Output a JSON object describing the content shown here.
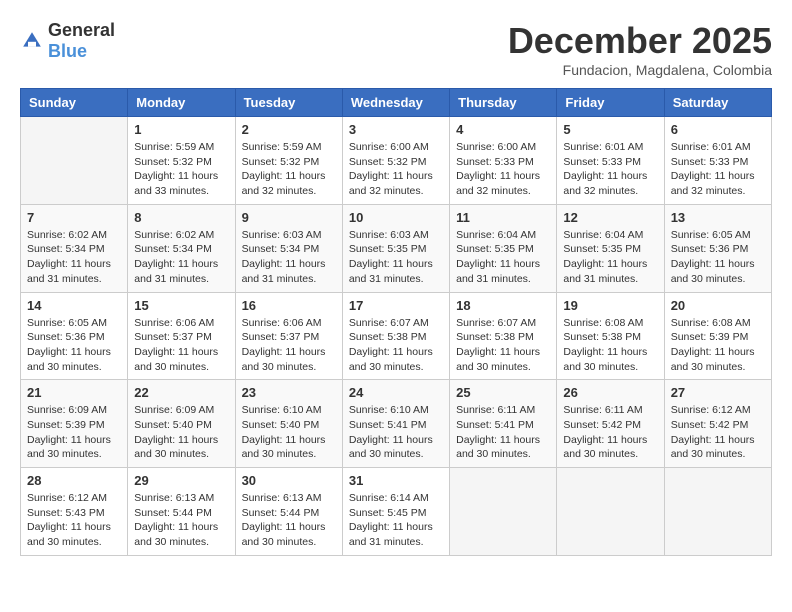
{
  "logo": {
    "general": "General",
    "blue": "Blue"
  },
  "title": "December 2025",
  "subtitle": "Fundacion, Magdalena, Colombia",
  "days_of_week": [
    "Sunday",
    "Monday",
    "Tuesday",
    "Wednesday",
    "Thursday",
    "Friday",
    "Saturday"
  ],
  "weeks": [
    [
      {
        "day": "",
        "info": ""
      },
      {
        "day": "1",
        "info": "Sunrise: 5:59 AM\nSunset: 5:32 PM\nDaylight: 11 hours\nand 33 minutes."
      },
      {
        "day": "2",
        "info": "Sunrise: 5:59 AM\nSunset: 5:32 PM\nDaylight: 11 hours\nand 32 minutes."
      },
      {
        "day": "3",
        "info": "Sunrise: 6:00 AM\nSunset: 5:32 PM\nDaylight: 11 hours\nand 32 minutes."
      },
      {
        "day": "4",
        "info": "Sunrise: 6:00 AM\nSunset: 5:33 PM\nDaylight: 11 hours\nand 32 minutes."
      },
      {
        "day": "5",
        "info": "Sunrise: 6:01 AM\nSunset: 5:33 PM\nDaylight: 11 hours\nand 32 minutes."
      },
      {
        "day": "6",
        "info": "Sunrise: 6:01 AM\nSunset: 5:33 PM\nDaylight: 11 hours\nand 32 minutes."
      }
    ],
    [
      {
        "day": "7",
        "info": "Sunrise: 6:02 AM\nSunset: 5:34 PM\nDaylight: 11 hours\nand 31 minutes."
      },
      {
        "day": "8",
        "info": "Sunrise: 6:02 AM\nSunset: 5:34 PM\nDaylight: 11 hours\nand 31 minutes."
      },
      {
        "day": "9",
        "info": "Sunrise: 6:03 AM\nSunset: 5:34 PM\nDaylight: 11 hours\nand 31 minutes."
      },
      {
        "day": "10",
        "info": "Sunrise: 6:03 AM\nSunset: 5:35 PM\nDaylight: 11 hours\nand 31 minutes."
      },
      {
        "day": "11",
        "info": "Sunrise: 6:04 AM\nSunset: 5:35 PM\nDaylight: 11 hours\nand 31 minutes."
      },
      {
        "day": "12",
        "info": "Sunrise: 6:04 AM\nSunset: 5:35 PM\nDaylight: 11 hours\nand 31 minutes."
      },
      {
        "day": "13",
        "info": "Sunrise: 6:05 AM\nSunset: 5:36 PM\nDaylight: 11 hours\nand 30 minutes."
      }
    ],
    [
      {
        "day": "14",
        "info": "Sunrise: 6:05 AM\nSunset: 5:36 PM\nDaylight: 11 hours\nand 30 minutes."
      },
      {
        "day": "15",
        "info": "Sunrise: 6:06 AM\nSunset: 5:37 PM\nDaylight: 11 hours\nand 30 minutes."
      },
      {
        "day": "16",
        "info": "Sunrise: 6:06 AM\nSunset: 5:37 PM\nDaylight: 11 hours\nand 30 minutes."
      },
      {
        "day": "17",
        "info": "Sunrise: 6:07 AM\nSunset: 5:38 PM\nDaylight: 11 hours\nand 30 minutes."
      },
      {
        "day": "18",
        "info": "Sunrise: 6:07 AM\nSunset: 5:38 PM\nDaylight: 11 hours\nand 30 minutes."
      },
      {
        "day": "19",
        "info": "Sunrise: 6:08 AM\nSunset: 5:38 PM\nDaylight: 11 hours\nand 30 minutes."
      },
      {
        "day": "20",
        "info": "Sunrise: 6:08 AM\nSunset: 5:39 PM\nDaylight: 11 hours\nand 30 minutes."
      }
    ],
    [
      {
        "day": "21",
        "info": "Sunrise: 6:09 AM\nSunset: 5:39 PM\nDaylight: 11 hours\nand 30 minutes."
      },
      {
        "day": "22",
        "info": "Sunrise: 6:09 AM\nSunset: 5:40 PM\nDaylight: 11 hours\nand 30 minutes."
      },
      {
        "day": "23",
        "info": "Sunrise: 6:10 AM\nSunset: 5:40 PM\nDaylight: 11 hours\nand 30 minutes."
      },
      {
        "day": "24",
        "info": "Sunrise: 6:10 AM\nSunset: 5:41 PM\nDaylight: 11 hours\nand 30 minutes."
      },
      {
        "day": "25",
        "info": "Sunrise: 6:11 AM\nSunset: 5:41 PM\nDaylight: 11 hours\nand 30 minutes."
      },
      {
        "day": "26",
        "info": "Sunrise: 6:11 AM\nSunset: 5:42 PM\nDaylight: 11 hours\nand 30 minutes."
      },
      {
        "day": "27",
        "info": "Sunrise: 6:12 AM\nSunset: 5:42 PM\nDaylight: 11 hours\nand 30 minutes."
      }
    ],
    [
      {
        "day": "28",
        "info": "Sunrise: 6:12 AM\nSunset: 5:43 PM\nDaylight: 11 hours\nand 30 minutes."
      },
      {
        "day": "29",
        "info": "Sunrise: 6:13 AM\nSunset: 5:44 PM\nDaylight: 11 hours\nand 30 minutes."
      },
      {
        "day": "30",
        "info": "Sunrise: 6:13 AM\nSunset: 5:44 PM\nDaylight: 11 hours\nand 30 minutes."
      },
      {
        "day": "31",
        "info": "Sunrise: 6:14 AM\nSunset: 5:45 PM\nDaylight: 11 hours\nand 31 minutes."
      },
      {
        "day": "",
        "info": ""
      },
      {
        "day": "",
        "info": ""
      },
      {
        "day": "",
        "info": ""
      }
    ]
  ]
}
